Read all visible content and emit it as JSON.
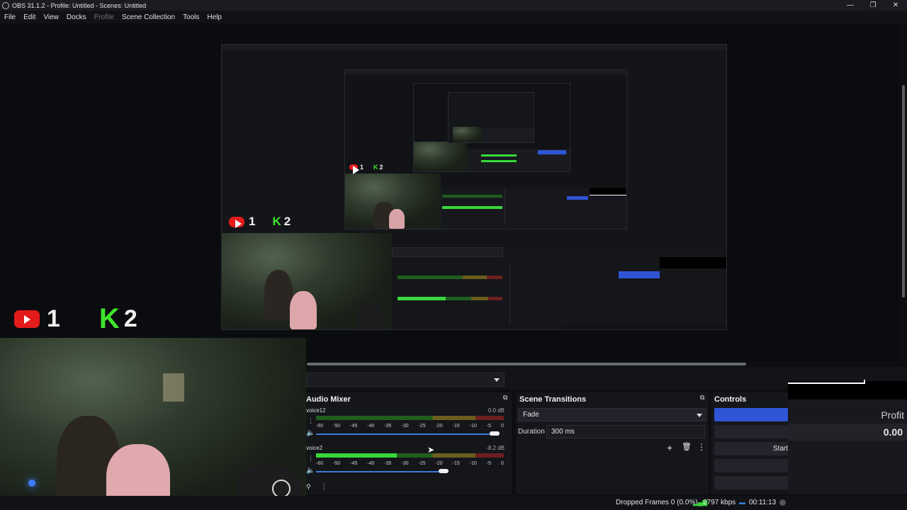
{
  "window": {
    "title": "OBS 31.1.2 - Profile: Untitled - Scenes: Untitled",
    "controls": [
      "—",
      "❐",
      "✕"
    ]
  },
  "menu": [
    "File",
    "Edit",
    "View",
    "Docks",
    "Profile",
    "Scene Collection",
    "Tools",
    "Help"
  ],
  "overlay": {
    "youtube_count": "1",
    "kick_count": "2",
    "kick_letter": "K"
  },
  "audio_mixer": {
    "title": "Audio Mixer",
    "channels": [
      {
        "name": "voice12",
        "db": "0.0 dB",
        "level": 0.0,
        "volume": 0.95
      },
      {
        "name": "voice2",
        "db": "-8.2 dB",
        "level": 0.43,
        "volume": 0.68
      }
    ],
    "scale": [
      "-60",
      "-50",
      "-45",
      "-40",
      "-35",
      "-30",
      "-25",
      "-20",
      "-15",
      "-10",
      "-5",
      "0"
    ]
  },
  "scene_transitions": {
    "title": "Scene Transitions",
    "transition": "Fade",
    "duration_label": "Duration",
    "duration_value": "300 ms"
  },
  "controls": {
    "title": "Controls",
    "start_label": "Start"
  },
  "profit_widget": {
    "label": "Profit",
    "value": "0.00"
  },
  "status": {
    "dropped_frames": "Dropped Frames 0 (0.0%)",
    "bitrate": "2797 kbps",
    "time": "00:11:13"
  },
  "colors": {
    "accent_blue": "#2f55d6",
    "meter_green": "#38d83a",
    "youtube_red": "#e31b1b",
    "kick_green": "#3ee52b"
  }
}
